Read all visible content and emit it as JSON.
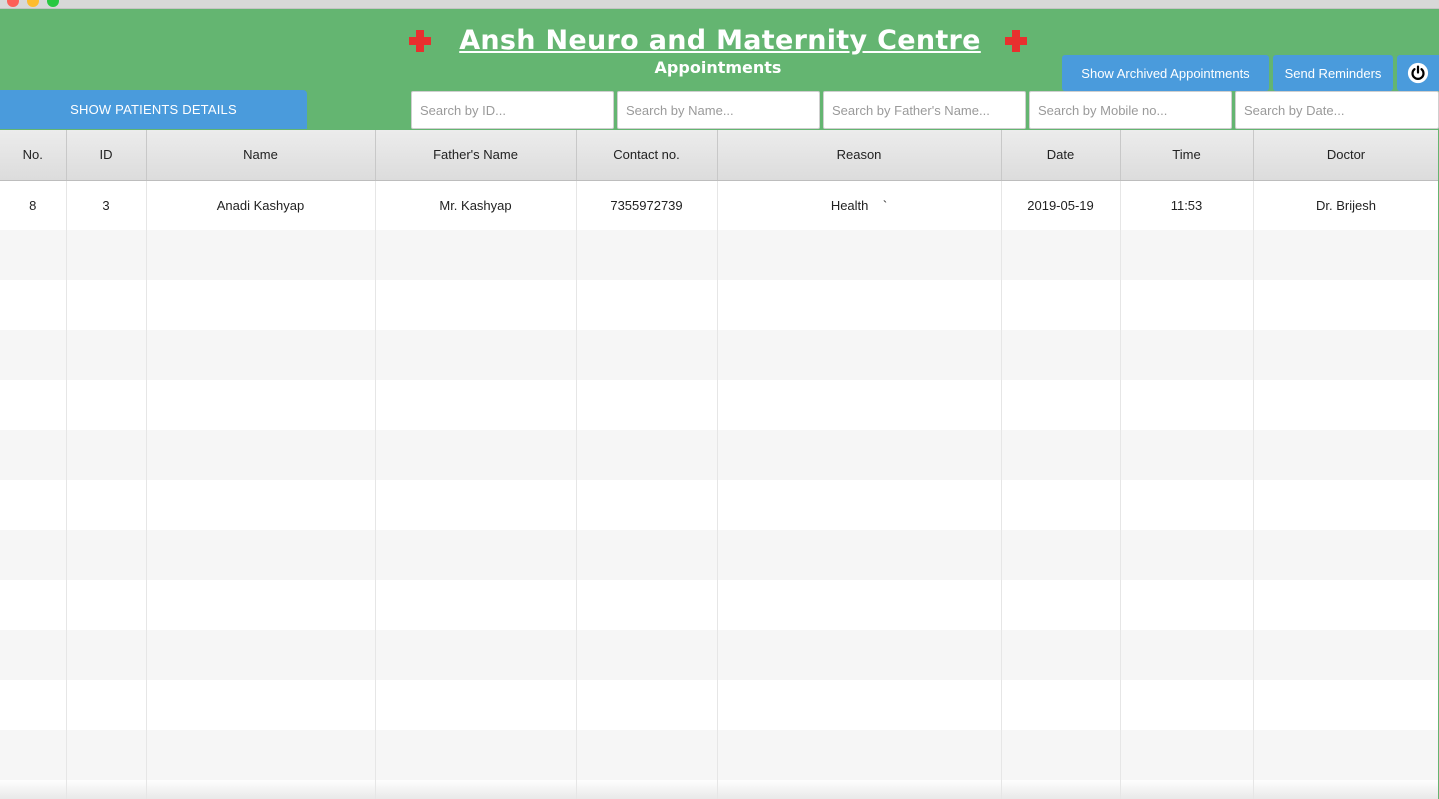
{
  "header": {
    "title": "Ansh Neuro and Maternity Centre",
    "subtitle": "Appointments"
  },
  "buttons": {
    "show_patients": "SHOW PATIENTS DETAILS",
    "show_archived": "Show Archived Appointments",
    "send_reminders": "Send Reminders",
    "power_icon": "power-icon"
  },
  "search": {
    "id_placeholder": "Search by ID...",
    "name_placeholder": "Search by Name...",
    "father_placeholder": "Search by Father's Name...",
    "mobile_placeholder": "Search by Mobile no...",
    "date_placeholder": "Search by Date..."
  },
  "table": {
    "columns": [
      "No.",
      "ID",
      "Name",
      "Father's Name",
      "Contact no.",
      "Reason",
      "Date",
      "Time",
      "Doctor"
    ],
    "rows": [
      [
        "8",
        "3",
        "Anadi Kashyap",
        "Mr. Kashyap",
        "7355972739",
        "Health    `",
        "2019-05-19",
        "11:53",
        "Dr. Brijesh"
      ]
    ]
  },
  "colors": {
    "header_green": "#64b571",
    "button_blue": "#4a9bdc",
    "cross_red": "#e8302e"
  }
}
